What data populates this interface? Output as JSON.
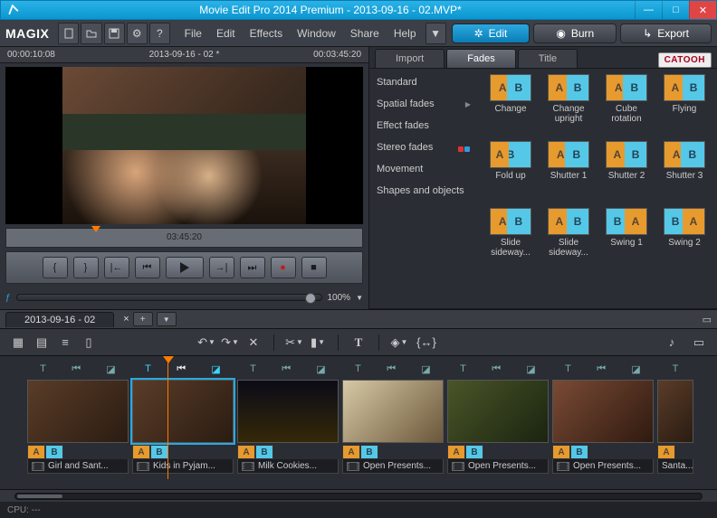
{
  "window": {
    "title": "Movie Edit Pro 2014 Premium - 2013-09-16 - 02.MVP*"
  },
  "brand": "MAGIX",
  "menus": [
    "File",
    "Edit",
    "Effects",
    "Window",
    "Share",
    "Help"
  ],
  "modes": {
    "edit": "Edit",
    "burn": "Burn",
    "export": "Export"
  },
  "preview": {
    "tc_start": "00:00:10:08",
    "project_name": "2013-09-16 - 02 *",
    "tc_end": "00:03:45:20",
    "ruler_tc": "03:45:20",
    "zoom": "100%"
  },
  "media": {
    "tabs": {
      "import": "Import",
      "fades": "Fades",
      "title": "Title"
    },
    "catooh": "CATOOH",
    "categories": {
      "standard": "Standard",
      "spatial": "Spatial fades",
      "effect": "Effect fades",
      "stereo": "Stereo fades",
      "movement": "Movement",
      "shapes": "Shapes and objects"
    },
    "fades": [
      {
        "name": "Change"
      },
      {
        "name": "Change upright"
      },
      {
        "name": "Cube rotation"
      },
      {
        "name": "Flying"
      },
      {
        "name": "Fold up"
      },
      {
        "name": "Shutter 1"
      },
      {
        "name": "Shutter 2"
      },
      {
        "name": "Shutter 3"
      },
      {
        "name": "Slide sideway..."
      },
      {
        "name": "Slide sideway..."
      },
      {
        "name": "Swing 1"
      },
      {
        "name": "Swing 2"
      }
    ]
  },
  "timeline": {
    "tab": "2013-09-16 - 02",
    "clips": [
      {
        "label": "Girl and Sant..."
      },
      {
        "label": "Kids in Pyjam..."
      },
      {
        "label": "Milk Cookies..."
      },
      {
        "label": "Open Presents..."
      },
      {
        "label": "Open Presents..."
      },
      {
        "label": "Open Presents..."
      },
      {
        "label": "Santa..."
      }
    ]
  },
  "status": {
    "cpu": "CPU: ---"
  },
  "ab": {
    "a": "A",
    "b": "B"
  }
}
